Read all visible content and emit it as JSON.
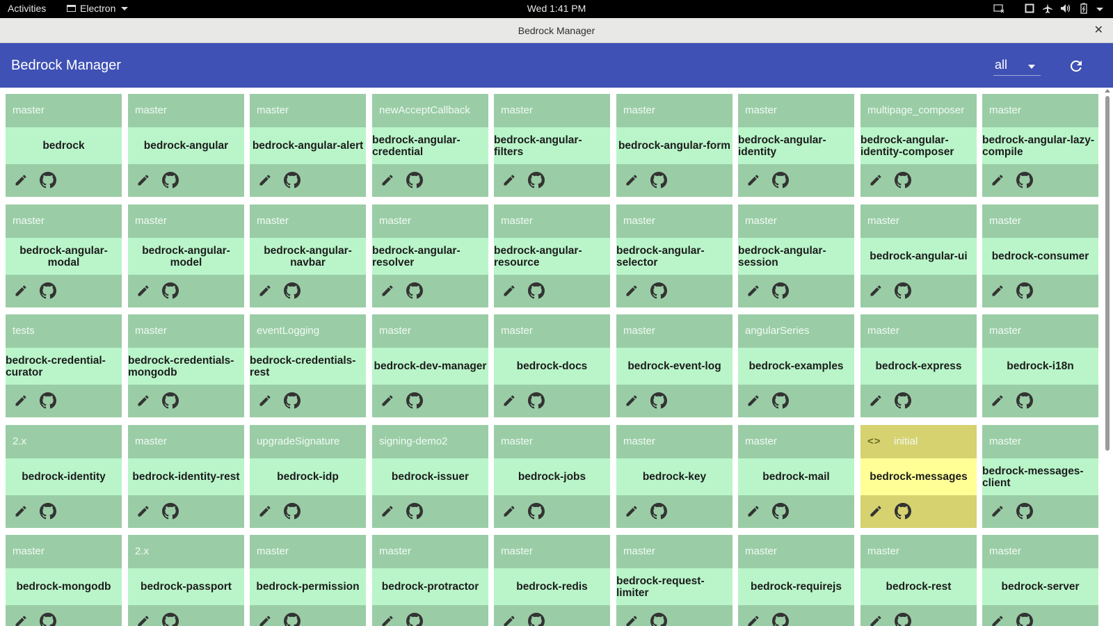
{
  "topbar": {
    "activities": "Activities",
    "app_name": "Electron",
    "clock": "Wed  1:41 PM"
  },
  "window": {
    "title": "Bedrock Manager"
  },
  "toolbar": {
    "title": "Bedrock Manager",
    "filter_value": "all"
  },
  "colors": {
    "toolbar": "#3f51b5",
    "card": "#9acda6",
    "card_name": "#b9f5c9",
    "active_card": "#d6d26f",
    "active_card_name": "#ffff96"
  },
  "repos": [
    {
      "branch": "master",
      "name": "bedrock"
    },
    {
      "branch": "master",
      "name": "bedrock-angular"
    },
    {
      "branch": "master",
      "name": "bedrock-angular-alert"
    },
    {
      "branch": "newAcceptCallback",
      "name": "bedrock-angular-credential"
    },
    {
      "branch": "master",
      "name": "bedrock-angular-filters"
    },
    {
      "branch": "master",
      "name": "bedrock-angular-form"
    },
    {
      "branch": "master",
      "name": "bedrock-angular-identity"
    },
    {
      "branch": "multipage_composer",
      "name": "bedrock-angular-identity-composer"
    },
    {
      "branch": "master",
      "name": "bedrock-angular-lazy-compile"
    },
    {
      "branch": "master",
      "name": "bedrock-angular-modal"
    },
    {
      "branch": "master",
      "name": "bedrock-angular-model"
    },
    {
      "branch": "master",
      "name": "bedrock-angular-navbar"
    },
    {
      "branch": "master",
      "name": "bedrock-angular-resolver"
    },
    {
      "branch": "master",
      "name": "bedrock-angular-resource"
    },
    {
      "branch": "master",
      "name": "bedrock-angular-selector"
    },
    {
      "branch": "master",
      "name": "bedrock-angular-session"
    },
    {
      "branch": "master",
      "name": "bedrock-angular-ui"
    },
    {
      "branch": "master",
      "name": "bedrock-consumer"
    },
    {
      "branch": "tests",
      "name": "bedrock-credential-curator"
    },
    {
      "branch": "master",
      "name": "bedrock-credentials-mongodb"
    },
    {
      "branch": "eventLogging",
      "name": "bedrock-credentials-rest"
    },
    {
      "branch": "master",
      "name": "bedrock-dev-manager"
    },
    {
      "branch": "master",
      "name": "bedrock-docs"
    },
    {
      "branch": "master",
      "name": "bedrock-event-log"
    },
    {
      "branch": "angularSeries",
      "name": "bedrock-examples"
    },
    {
      "branch": "master",
      "name": "bedrock-express"
    },
    {
      "branch": "master",
      "name": "bedrock-i18n"
    },
    {
      "branch": "2.x",
      "name": "bedrock-identity"
    },
    {
      "branch": "master",
      "name": "bedrock-identity-rest"
    },
    {
      "branch": "upgradeSignature",
      "name": "bedrock-idp"
    },
    {
      "branch": "signing-demo2",
      "name": "bedrock-issuer"
    },
    {
      "branch": "master",
      "name": "bedrock-jobs"
    },
    {
      "branch": "master",
      "name": "bedrock-key"
    },
    {
      "branch": "master",
      "name": "bedrock-mail"
    },
    {
      "branch": "initial",
      "name": "bedrock-messages",
      "active": true
    },
    {
      "branch": "master",
      "name": "bedrock-messages-client"
    },
    {
      "branch": "master",
      "name": "bedrock-mongodb"
    },
    {
      "branch": "2.x",
      "name": "bedrock-passport"
    },
    {
      "branch": "master",
      "name": "bedrock-permission"
    },
    {
      "branch": "master",
      "name": "bedrock-protractor"
    },
    {
      "branch": "master",
      "name": "bedrock-redis"
    },
    {
      "branch": "master",
      "name": "bedrock-request-limiter"
    },
    {
      "branch": "master",
      "name": "bedrock-requirejs"
    },
    {
      "branch": "master",
      "name": "bedrock-rest"
    },
    {
      "branch": "master",
      "name": "bedrock-server"
    }
  ]
}
